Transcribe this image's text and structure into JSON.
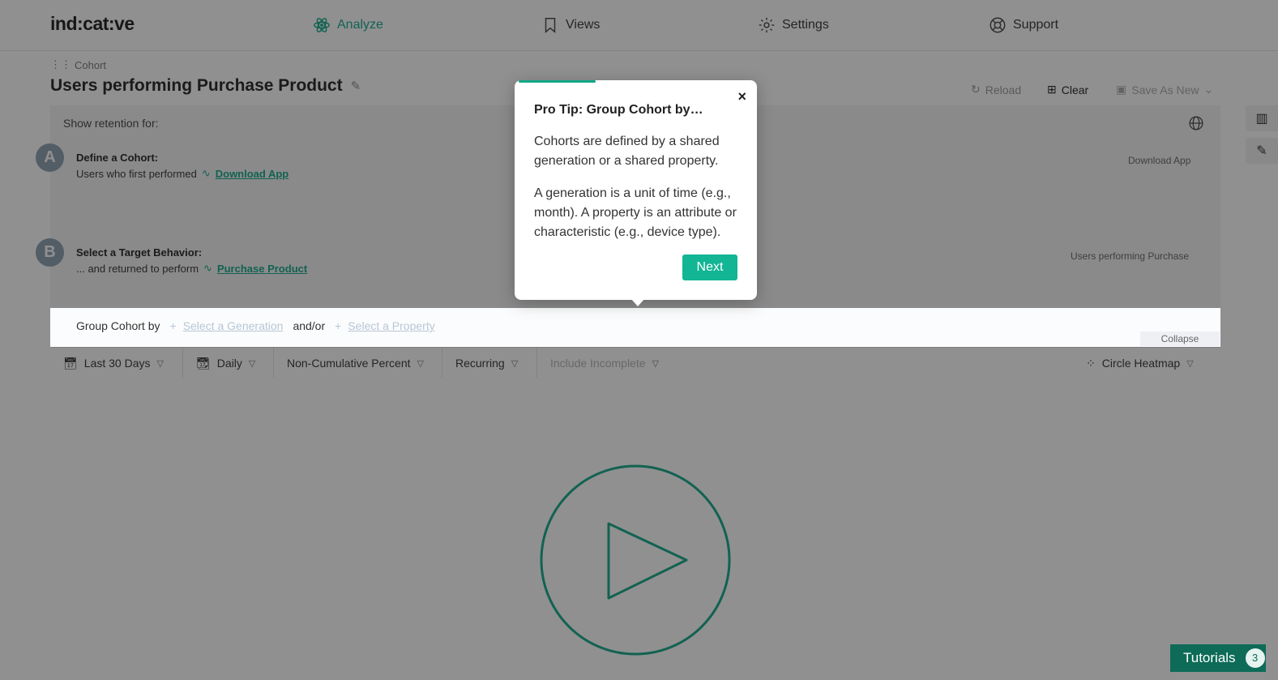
{
  "app": {
    "logo": "ind:cat:ve"
  },
  "nav": [
    {
      "label": "Analyze",
      "icon": "atom-icon"
    },
    {
      "label": "Views",
      "icon": "bookmark-icon"
    },
    {
      "label": "Settings",
      "icon": "gear-icon"
    },
    {
      "label": "Support",
      "icon": "lifebuoy-icon"
    }
  ],
  "breadcrumb": "Cohort",
  "page_title": "Users performing Purchase Product",
  "actions": {
    "reload": "Reload",
    "clear": "Clear",
    "save_as_new": "Save As New"
  },
  "show_retention": "Show retention for:",
  "steps": {
    "a": {
      "badge": "A",
      "title": "Define a Cohort:",
      "prefix": "Users who first performed",
      "event": "Download App",
      "right": "Download App"
    },
    "b": {
      "badge": "B",
      "title": "Select a Target Behavior:",
      "prefix": "... and returned to perform",
      "event": "Purchase Product",
      "right": "Users performing Purchase"
    }
  },
  "group_cohort": {
    "label": "Group Cohort by",
    "generation": "Select a Generation",
    "andor": "and/or",
    "property": "Select a Property",
    "collapse": "Collapse"
  },
  "filters": {
    "date_range": "Last 30 Days",
    "interval": "Daily",
    "mode": "Non-Cumulative Percent",
    "recurring": "Recurring",
    "include_incomplete": "Include Incomplete",
    "chart_type": "Circle Heatmap"
  },
  "popover": {
    "title": "Pro Tip: Group Cohort by…",
    "p1": "Cohorts are defined by a shared generation or a shared property.",
    "p2": "A generation is a unit of time (e.g., month). A property is an attribute or characteristic (e.g., device type).",
    "next": "Next",
    "close": "×",
    "progress": 0.33
  },
  "tutorials": {
    "label": "Tutorials",
    "count": "3"
  },
  "colors": {
    "accent": "#11a888",
    "dark_accent": "#0d6b57"
  }
}
